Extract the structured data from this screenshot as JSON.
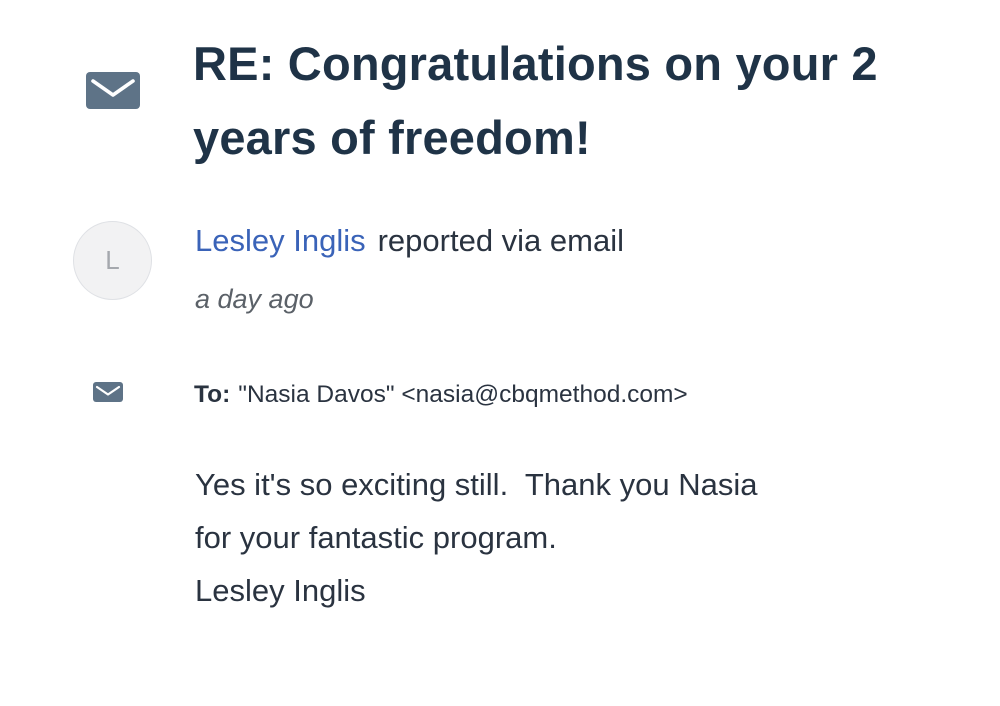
{
  "ticket": {
    "type_icon": "envelope-icon",
    "title": "RE: Congratulations on your 2 years of freedom!"
  },
  "author": {
    "avatar_initial": "L",
    "name": "Lesley Inglis",
    "action": "reported via email",
    "timestamp": "a day ago"
  },
  "recipient": {
    "icon": "envelope-icon",
    "label": "To:",
    "value": "\"Nasia Davos\" <nasia@cbqmethod.com>"
  },
  "message": {
    "lines": [
      "Yes it's so exciting still.  Thank you Nasia",
      "for your fantastic program.",
      "Lesley Inglis"
    ]
  },
  "colors": {
    "title": "#1f3347",
    "link": "#3a63b8",
    "text": "#2a3340",
    "muted": "#5b6168",
    "icon": "#5e7387"
  }
}
